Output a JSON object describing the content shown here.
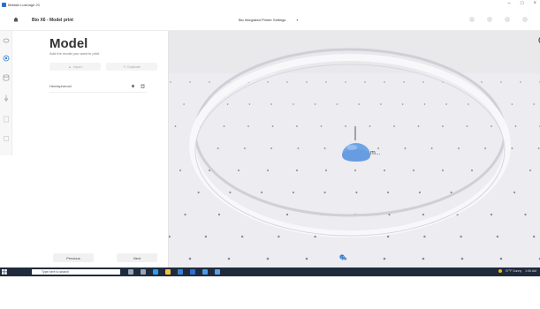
{
  "window": {
    "title": "Mattaki Lusinage 20",
    "controls": [
      "–",
      "□",
      "×"
    ]
  },
  "header": {
    "project_title": "Bio X6 - Model print",
    "printer_select": "Bio Integrated Printer Settings"
  },
  "rail": {
    "icons": [
      "layers-icon",
      "model-icon",
      "database-icon",
      "dropper-icon",
      "document-icon",
      "grid-icon"
    ]
  },
  "panel": {
    "title": "Model",
    "subtitle": "Add the model you want to print",
    "buttons": [
      {
        "label": "Import",
        "icon": "upload-icon"
      },
      {
        "label": "Duplicate",
        "icon": "copy-icon"
      }
    ],
    "models": [
      {
        "name": "Hemispheroid"
      }
    ],
    "footer": {
      "previous_label": "Previous",
      "next_label": "Next"
    }
  },
  "viewport": {
    "object_label": "m...",
    "view_icons": [
      "view-iso-icon",
      "view-top-icon",
      "view-front-icon",
      "view-side-icon"
    ],
    "bottom_tools": [
      "rotate-icon",
      "move-icon",
      "zoom-out-icon",
      "zoom-in-icon"
    ],
    "colors": {
      "background": "#e9e9ec",
      "plate": "#ededf2",
      "sphere": "#6fa4e6",
      "dots": "#8a8a96"
    }
  },
  "taskbar": {
    "search_placeholder": "Type here to search",
    "tray_text": "97°F Sunny",
    "clock": "1:06 AM"
  }
}
